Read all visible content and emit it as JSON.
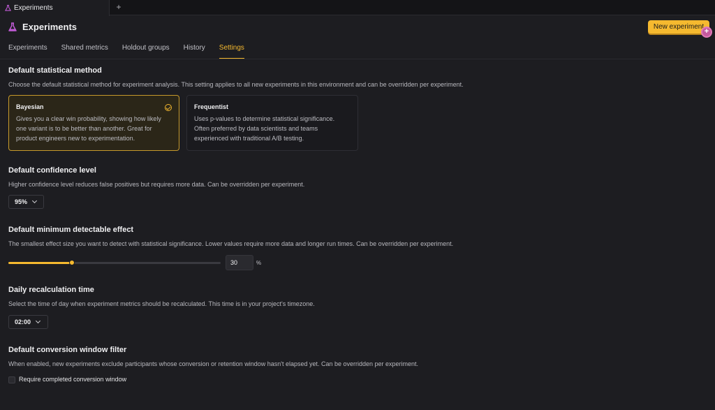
{
  "browser_tab": {
    "title": "Experiments",
    "add_label": "+"
  },
  "header": {
    "title": "Experiments",
    "new_button": "New experiment",
    "badge": "+"
  },
  "nav": {
    "tabs": [
      "Experiments",
      "Shared metrics",
      "Holdout groups",
      "History",
      "Settings"
    ],
    "active": "Settings"
  },
  "stat_method": {
    "title": "Default statistical method",
    "description": "Choose the default statistical method for experiment analysis. This setting applies to all new experiments in this environment and can be overridden per experiment.",
    "options": [
      {
        "title": "Bayesian",
        "selected": true,
        "lines": [
          "Gives you a clear win probability, showing how likely",
          "one variant is to be better than another. Great for",
          "product engineers new to experimentation."
        ]
      },
      {
        "title": "Frequentist",
        "selected": false,
        "lines": [
          "Uses p-values to determine statistical significance.",
          "Often preferred by data scientists and teams",
          "experienced with traditional A/B testing."
        ]
      }
    ]
  },
  "confidence": {
    "title": "Default confidence level",
    "description": "Higher confidence level reduces false positives but requires more data. Can be overridden per experiment.",
    "value": "95%"
  },
  "mde": {
    "title": "Default minimum detectable effect",
    "description": "The smallest effect size you want to detect with statistical significance. Lower values require more data and longer run times. Can be overridden per experiment.",
    "value": "30",
    "unit": "%",
    "slider_fraction": 0.3
  },
  "recalc": {
    "title": "Daily recalculation time",
    "description": "Select the time of day when experiment metrics should be recalculated. This time is in your project's timezone.",
    "value": "02:00"
  },
  "conversion": {
    "title": "Default conversion window filter",
    "description": "When enabled, new experiments exclude participants whose conversion or retention window hasn't elapsed yet. Can be overridden per experiment.",
    "checkbox_label": "Require completed conversion window",
    "checked": false
  },
  "colors": {
    "accent": "#f5b92f",
    "background": "#1d1d21",
    "flask": "#c15bd6"
  }
}
